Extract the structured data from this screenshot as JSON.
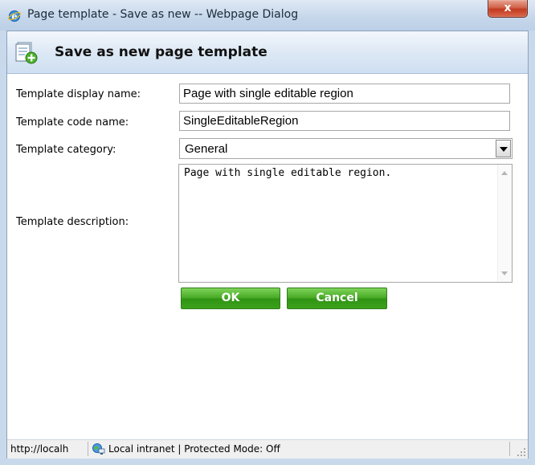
{
  "window": {
    "title": "Page template - Save as new -- Webpage Dialog",
    "close_label": "x"
  },
  "header": {
    "title": "Save as new page template",
    "icon": "page-template-add-icon"
  },
  "form": {
    "display_name": {
      "label": "Template display name:",
      "value": "Page with single editable region"
    },
    "code_name": {
      "label": "Template code name:",
      "value": "SingleEditableRegion"
    },
    "category": {
      "label": "Template category:",
      "value": "General"
    },
    "description": {
      "label": "Template description:",
      "value": "Page with single editable region."
    }
  },
  "buttons": {
    "ok": "OK",
    "cancel": "Cancel"
  },
  "statusbar": {
    "url": "http://localh",
    "zone": "Local intranet | Protected Mode: Off"
  },
  "colors": {
    "button_green": "#46a823",
    "header_bg": "#dbe7f4",
    "close_red": "#c23a1f"
  }
}
